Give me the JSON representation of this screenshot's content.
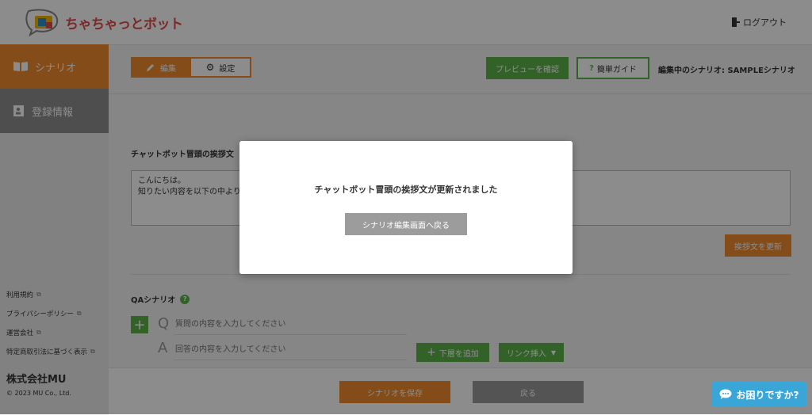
{
  "header": {
    "logo_text": "ちゃちゃっとボット",
    "logout_label": "ログアウト"
  },
  "sidebar": {
    "items": [
      {
        "label": "シナリオ",
        "icon": "book-icon"
      },
      {
        "label": "登録情報",
        "icon": "contact-card-icon"
      }
    ],
    "links": [
      "利用規約",
      "プライバシーポリシー",
      "運営会社",
      "特定商取引法に基づく表示"
    ],
    "brand": "株式会社MU",
    "copyright": "© 2023 MU Co., Ltd."
  },
  "toolbar": {
    "edit_label": "編集",
    "settings_label": "設定",
    "preview_label": "プレビューを確認",
    "guide_label": "簡単ガイド",
    "editing_scenario": "編集中のシナリオ: SAMPLEシナリオ"
  },
  "greeting": {
    "label": "チャットボット冒頭の挨拶文",
    "line1": "こんにちは。",
    "line2": "知りたい内容を以下の中より",
    "update_label": "挨拶文を更新"
  },
  "qa": {
    "label": "QAシナリオ",
    "q_letter": "Q",
    "a_letter": "A",
    "q_placeholder": "質問の内容を入力してください",
    "a_placeholder": "回答の内容を入力してください",
    "add_lower_label": "下層を追加",
    "link_insert_label": "リンク挿入"
  },
  "footer": {
    "save_label": "シナリオを保存",
    "back_label": "戻る"
  },
  "help_chat": {
    "label": "お困りですか?"
  },
  "modal": {
    "message": "チャットボット冒頭の挨拶文が更新されました",
    "button_label": "シナリオ編集画面へ戻る"
  },
  "colors": {
    "accent_orange": "#f08a2c",
    "accent_green": "#5db34b",
    "help_blue": "#3aa6d8"
  }
}
